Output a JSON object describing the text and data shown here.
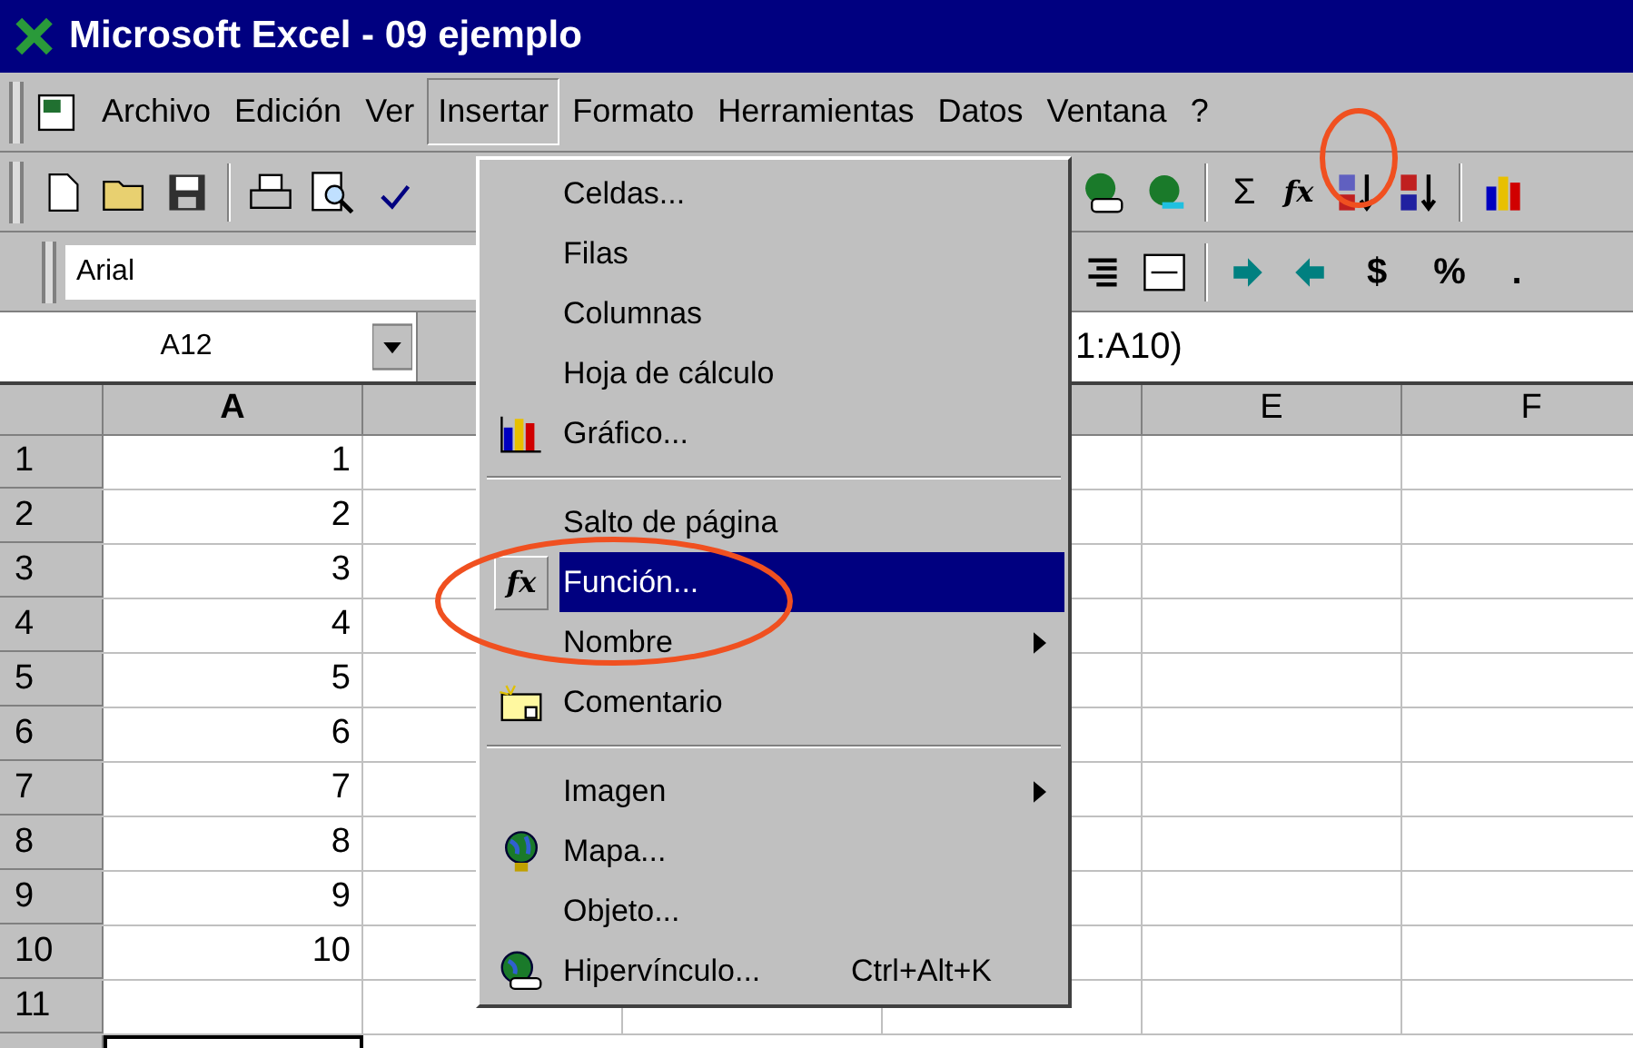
{
  "window": {
    "title": "Microsoft Excel - 09 ejemplo"
  },
  "menu_bar": [
    {
      "label": "Archivo",
      "selected": false
    },
    {
      "label": "Edición",
      "selected": false
    },
    {
      "label": "Ver",
      "selected": false
    },
    {
      "label": "Insertar",
      "selected": true
    },
    {
      "label": "Formato",
      "selected": false
    },
    {
      "label": "Herramientas",
      "selected": false
    },
    {
      "label": "Datos",
      "selected": false
    },
    {
      "label": "Ventana",
      "selected": false
    },
    {
      "label": "?",
      "selected": false
    }
  ],
  "standard_toolbar": {
    "sum_symbol": "Σ",
    "function_symbol": "fx"
  },
  "format_toolbar": {
    "font": "Arial",
    "currency_symbol": "$",
    "percent_symbol": "%",
    "comma_symbol": "."
  },
  "formula_bar": {
    "name_box": "A12",
    "formula": "1:A10)"
  },
  "columns": [
    {
      "label": "A"
    },
    {},
    {},
    {},
    {
      "label": "E"
    },
    {
      "label": "F"
    }
  ],
  "rows": [
    {
      "header": "1",
      "cells": [
        "1"
      ]
    },
    {
      "header": "2",
      "cells": [
        "2"
      ]
    },
    {
      "header": "3",
      "cells": [
        "3"
      ]
    },
    {
      "header": "4",
      "cells": [
        "4"
      ]
    },
    {
      "header": "5",
      "cells": [
        "5"
      ]
    },
    {
      "header": "6",
      "cells": [
        "6"
      ]
    },
    {
      "header": "7",
      "cells": [
        "7"
      ]
    },
    {
      "header": "8",
      "cells": [
        "8"
      ]
    },
    {
      "header": "9",
      "cells": [
        "9"
      ]
    },
    {
      "header": "10",
      "cells": [
        "10"
      ]
    },
    {
      "header": "11",
      "cells": []
    }
  ],
  "insert_menu": [
    {
      "kind": "plain",
      "label": "Celdas...",
      "selected": false
    },
    {
      "kind": "plain",
      "label": "Filas",
      "selected": false
    },
    {
      "kind": "plain",
      "label": "Columnas",
      "selected": false
    },
    {
      "kind": "plain",
      "label": "Hoja de cálculo",
      "selected": false
    },
    {
      "kind": "chart",
      "label": "Gráfico...",
      "selected": false
    },
    {
      "kind": "separator"
    },
    {
      "kind": "plain",
      "label": "Salto de página",
      "selected": false
    },
    {
      "kind": "function",
      "symbol": "fx",
      "label": "Función...",
      "selected": true
    },
    {
      "kind": "submenu",
      "label": "Nombre",
      "selected": false
    },
    {
      "kind": "comment",
      "label": "Comentario",
      "selected": false
    },
    {
      "kind": "separator"
    },
    {
      "kind": "submenu",
      "label": "Imagen",
      "selected": false
    },
    {
      "kind": "globe",
      "label": "Mapa...",
      "selected": false
    },
    {
      "kind": "plain",
      "label": "Objeto...",
      "selected": false
    },
    {
      "kind": "link",
      "label": "Hipervínculo...",
      "shortcut": "Ctrl+Alt+K",
      "selected": false
    }
  ]
}
